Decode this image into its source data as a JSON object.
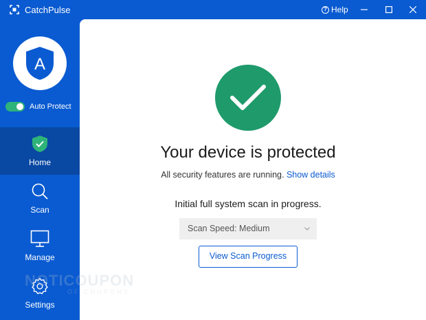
{
  "window": {
    "title": "CatchPulse",
    "help_label": "Help"
  },
  "sidebar": {
    "brand_letter": "A",
    "auto_protect": {
      "label": "Auto Protect",
      "enabled": true
    },
    "items": [
      {
        "label": "Home",
        "icon": "shield-check-icon",
        "active": true
      },
      {
        "label": "Scan",
        "icon": "search-icon",
        "active": false
      },
      {
        "label": "Manage",
        "icon": "monitor-icon",
        "active": false
      },
      {
        "label": "Settings",
        "icon": "gear-icon",
        "active": false
      }
    ]
  },
  "main": {
    "headline": "Your device is protected",
    "status_text": "All security features are running.",
    "details_link": "Show details",
    "scan_status": "Initial full system scan in progress.",
    "scan_speed_value": "Scan Speed: Medium",
    "view_progress_button": "View Scan Progress"
  },
  "watermark": {
    "main": "NOTICOUPON",
    "sub": "OF COUPONS"
  },
  "colors": {
    "brand_blue": "#0a5bd1",
    "active_nav": "#0948a3",
    "success_green": "#1f9a6b",
    "toggle_green": "#2eb37a"
  }
}
